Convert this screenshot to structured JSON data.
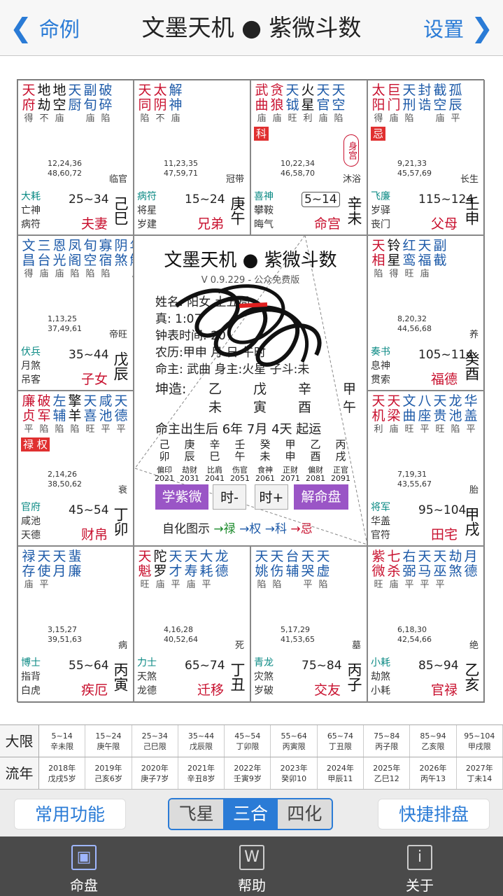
{
  "nav": {
    "back_label": "命例",
    "title": "文墨天机 ● 紫微斗数",
    "settings_label": "设置"
  },
  "palaces": [
    {
      "stars": [
        [
          "天府",
          "得",
          "red"
        ],
        [
          "地劫",
          "不",
          "blk"
        ],
        [
          "地空",
          "庙",
          "blk"
        ],
        [
          "天厨",
          "",
          "blue"
        ],
        [
          "副旬",
          "庙",
          "blue"
        ],
        [
          "破碎",
          "陷",
          "blue"
        ]
      ],
      "nums": [
        "12,24,36",
        "48,60,72"
      ],
      "changsheng": "临官",
      "g1": "大耗",
      "g2": "亡神",
      "g3": "病符",
      "range": "25~34",
      "name": "夫妻",
      "gz": "己巳"
    },
    {
      "stars": [
        [
          "天同",
          "陷",
          "red"
        ],
        [
          "太阴",
          "不",
          "red"
        ],
        [
          "解神",
          "庙",
          "blue"
        ]
      ],
      "nums": [
        "11,23,35",
        "47,59,71"
      ],
      "changsheng": "冠带",
      "g1": "病符",
      "g2": "将星",
      "g3": "岁建",
      "range": "15~24",
      "name": "兄弟",
      "gz": "庚午"
    },
    {
      "stars": [
        [
          "武曲",
          "庙",
          "red"
        ],
        [
          "贪狼",
          "庙",
          "red"
        ],
        [
          "天钺",
          "旺",
          "blue"
        ],
        [
          "火星",
          "利",
          "blk"
        ],
        [
          "天官",
          "庙",
          "blue"
        ],
        [
          "天空",
          "陷",
          "blue"
        ]
      ],
      "hua": "科",
      "shengong": "身宫",
      "nums": [
        "10,22,34",
        "46,58,70"
      ],
      "changsheng": "沐浴",
      "g1": "喜神",
      "g2": "攀鞍",
      "g3": "晦气",
      "range": "5~14",
      "name": "命宫",
      "gz": "辛未"
    },
    {
      "stars": [
        [
          "太阳",
          "得",
          "red"
        ],
        [
          "巨门",
          "庙",
          "red"
        ],
        [
          "天刑",
          "陷",
          "blue"
        ],
        [
          "封诰",
          "",
          "blue"
        ],
        [
          "截空",
          "庙",
          "blue"
        ],
        [
          "孤辰",
          "平",
          "blue"
        ]
      ],
      "hua": "忌",
      "nums": [
        "9,21,33",
        "45,57,69"
      ],
      "changsheng": "长生",
      "g1": "飞廉",
      "g2": "岁驿",
      "g3": "丧门",
      "range": "115~124",
      "name": "父母",
      "gz": "壬申"
    },
    {
      "stars": [
        [
          "文昌",
          "得",
          "blue"
        ],
        [
          "三台",
          "庙",
          "blue"
        ],
        [
          "恩光",
          "庙",
          "blue"
        ],
        [
          "凤阁",
          "陷",
          "blue"
        ],
        [
          "旬空",
          "陷",
          "blue"
        ],
        [
          "寡宿",
          "陷",
          "blue"
        ],
        [
          "阴煞",
          "",
          "blue"
        ],
        [
          "年解",
          "庙",
          "blue"
        ]
      ],
      "nums": [
        "1,13,25",
        "37,49,61"
      ],
      "changsheng": "帝旺",
      "g1": "伏兵",
      "g2": "月煞",
      "g3": "吊客",
      "range": "35~44",
      "name": "子女",
      "gz": "戊辰"
    },
    {
      "stars": [
        [
          "天相",
          "陷",
          "red"
        ],
        [
          "铃星",
          "得",
          "blk"
        ],
        [
          "红鸾",
          "旺",
          "blue"
        ],
        [
          "天福",
          "庙",
          "blue"
        ],
        [
          "副截",
          "",
          "blue"
        ]
      ],
      "nums": [
        "8,20,32",
        "44,56,68"
      ],
      "changsheng": "养",
      "g1": "奏书",
      "g2": "息神",
      "g3": "贯索",
      "range": "105~114",
      "name": "福德",
      "gz": "癸酉"
    },
    {
      "stars": [
        [
          "廉贞",
          "平",
          "red"
        ],
        [
          "破军",
          "陷",
          "red"
        ],
        [
          "左辅",
          "陷",
          "blue"
        ],
        [
          "擎羊",
          "陷",
          "blk"
        ],
        [
          "天喜",
          "旺",
          "blue"
        ],
        [
          "咸池",
          "平",
          "blue"
        ],
        [
          "天德",
          "平",
          "blue"
        ]
      ],
      "hua": "禄 权",
      "nums": [
        "2,14,26",
        "38,50,62"
      ],
      "changsheng": "衰",
      "g1": "官府",
      "g2": "咸池",
      "g3": "天德",
      "range": "45~54",
      "name": "财帛",
      "gz": "丁卯"
    },
    {
      "stars": [
        [
          "天机",
          "利",
          "red"
        ],
        [
          "天梁",
          "庙",
          "red"
        ],
        [
          "文曲",
          "旺",
          "blue"
        ],
        [
          "八座",
          "平",
          "blue"
        ],
        [
          "天贵",
          "旺",
          "blue"
        ],
        [
          "龙池",
          "陷",
          "blue"
        ],
        [
          "华盖",
          "平",
          "blue"
        ]
      ],
      "nums": [
        "7,19,31",
        "43,55,67"
      ],
      "changsheng": "胎",
      "g1": "将军",
      "g2": "华盖",
      "g3": "官符",
      "range": "95~104",
      "name": "田宅",
      "gz": "甲戌"
    },
    {
      "stars": [
        [
          "禄存",
          "庙",
          "blue"
        ],
        [
          "天使",
          "平",
          "blue"
        ],
        [
          "天月",
          "",
          "blue"
        ],
        [
          "蜚廉",
          "",
          "blue"
        ]
      ],
      "nums": [
        "3,15,27",
        "39,51,63"
      ],
      "changsheng": "病",
      "g1": "博士",
      "g2": "指背",
      "g3": "白虎",
      "range": "55~64",
      "name": "疾厄",
      "gz": "丙寅"
    },
    {
      "stars": [
        [
          "天魁",
          "旺",
          "red"
        ],
        [
          "陀罗",
          "庙",
          "blk"
        ],
        [
          "天才",
          "平",
          "blue"
        ],
        [
          "天寿",
          "庙",
          "blue"
        ],
        [
          "大耗",
          "平",
          "blue"
        ],
        [
          "龙德",
          "",
          "blue"
        ]
      ],
      "nums": [
        "4,16,28",
        "40,52,64"
      ],
      "changsheng": "死",
      "g1": "力士",
      "g2": "天煞",
      "g3": "龙德",
      "range": "65~74",
      "name": "迁移",
      "gz": "丁丑"
    },
    {
      "stars": [
        [
          "天姚",
          "陷",
          "blue"
        ],
        [
          "天伤",
          "陷",
          "blue"
        ],
        [
          "台辅",
          "",
          "blue"
        ],
        [
          "天哭",
          "平",
          "blue"
        ],
        [
          "天虚",
          "陷",
          "blue"
        ]
      ],
      "nums": [
        "5,17,29",
        "41,53,65"
      ],
      "changsheng": "墓",
      "g1": "青龙",
      "g2": "灾煞",
      "g3": "岁破",
      "range": "75~84",
      "name": "交友",
      "gz": "丙子"
    },
    {
      "stars": [
        [
          "紫微",
          "旺",
          "red"
        ],
        [
          "七杀",
          "庙",
          "red"
        ],
        [
          "右弼",
          "平",
          "blue"
        ],
        [
          "天马",
          "平",
          "blue"
        ],
        [
          "天巫",
          "平",
          "blue"
        ],
        [
          "劫煞",
          "",
          "blue"
        ],
        [
          "月德",
          "",
          "blue"
        ]
      ],
      "nums": [
        "6,18,30",
        "42,54,66"
      ],
      "changsheng": "绝",
      "g1": "小耗",
      "g2": "劫煞",
      "g3": "小耗",
      "range": "85~94",
      "name": "官禄",
      "gz": "乙亥"
    }
  ],
  "center": {
    "title": "文墨天机 ● 紫微斗数",
    "version": "V 0.9.229 - 公众免费版",
    "line1": "姓名:          阳女 土五局",
    "line2": "真:                  1:07",
    "line3": "钟表时间:              20",
    "line4": "农历:甲申    月    日 午时",
    "line5": "命主: 武曲 身主:火星 子斗:未",
    "bazi_label": "坤造:",
    "bazi_top": [
      "乙",
      "戊",
      "辛",
      "甲"
    ],
    "bazi_bot": [
      "未",
      "寅",
      "酉",
      "午"
    ],
    "qiyun": "命主出生后 6年 7月 4天 起运",
    "dayun_top": [
      "己",
      "庚",
      "辛",
      "壬",
      "癸",
      "甲",
      "乙",
      "丙"
    ],
    "dayun_mid": [
      "卯",
      "辰",
      "巳",
      "午",
      "未",
      "申",
      "酉",
      "戌"
    ],
    "dayun_shi": [
      "偏印",
      "劫财",
      "比肩",
      "伤官",
      "食神",
      "正财",
      "偏财",
      "正官"
    ],
    "dayun_year": [
      "2021",
      "2031",
      "2041",
      "2051",
      "2061",
      "2071",
      "2081",
      "2091"
    ],
    "buttons": {
      "learn": "学紫微",
      "shi_minus": "时-",
      "shi_plus": "时+",
      "jie": "解命盘"
    },
    "sihua": {
      "label": "自化图示",
      "lu": "→禄",
      "quan": "→权",
      "ke": "→科",
      "ji": "→忌"
    }
  },
  "daxian": {
    "label": "大限",
    "cells": [
      [
        "5~14",
        "辛未限"
      ],
      [
        "15~24",
        "庚午限"
      ],
      [
        "25~34",
        "己巳限"
      ],
      [
        "35~44",
        "戊辰限"
      ],
      [
        "45~54",
        "丁卯限"
      ],
      [
        "55~64",
        "丙寅限"
      ],
      [
        "65~74",
        "丁丑限"
      ],
      [
        "75~84",
        "丙子限"
      ],
      [
        "85~94",
        "乙亥限"
      ],
      [
        "95~104",
        "甲戌限"
      ]
    ]
  },
  "liunian": {
    "label": "流年",
    "cells": [
      [
        "2018年",
        "戊戌5岁"
      ],
      [
        "2019年",
        "己亥6岁"
      ],
      [
        "2020年",
        "庚子7岁"
      ],
      [
        "2021年",
        "辛丑8岁"
      ],
      [
        "2022年",
        "壬寅9岁"
      ],
      [
        "2023年",
        "癸卯10"
      ],
      [
        "2024年",
        "甲辰11"
      ],
      [
        "2025年",
        "乙巳12"
      ],
      [
        "2026年",
        "丙午13"
      ],
      [
        "2027年",
        "丁未14"
      ]
    ]
  },
  "tools": {
    "common": "常用功能",
    "seg": [
      "飞星",
      "三合",
      "四化"
    ],
    "seg_active": 1,
    "quick": "快捷排盘"
  },
  "tabs": [
    {
      "label": "命盘",
      "icon": "palace-icon"
    },
    {
      "label": "帮助",
      "icon": "help-icon"
    },
    {
      "label": "关于",
      "icon": "info-icon"
    }
  ],
  "colors": {
    "accent": "#2a7bd6",
    "red": "#c8102e",
    "purple": "#9a55c6",
    "tabbar": "#4a4a4a"
  }
}
